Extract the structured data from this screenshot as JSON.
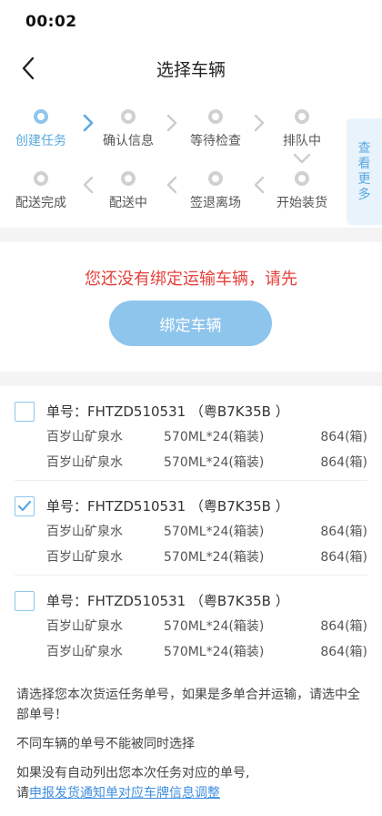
{
  "status": {
    "time": "00:02"
  },
  "header": {
    "title": "选择车辆"
  },
  "steps": [
    {
      "label": "创建任务",
      "active": true
    },
    {
      "label": "确认信息",
      "active": false
    },
    {
      "label": "等待检查",
      "active": false
    },
    {
      "label": "排队中",
      "active": false
    },
    {
      "label": "开始装货",
      "active": false
    },
    {
      "label": "签退离场",
      "active": false
    },
    {
      "label": "配送中",
      "active": false
    },
    {
      "label": "配送完成",
      "active": false
    }
  ],
  "more_tab": {
    "chars": [
      "查",
      "看",
      "更",
      "多"
    ]
  },
  "bind": {
    "warning": "您还没有绑定运输车辆，请先",
    "button": "绑定车辆"
  },
  "orders": [
    {
      "checked": false,
      "number": "单号：FHTZD510531 （粤B7K35B ）",
      "items": [
        {
          "name": "百岁山矿泉水",
          "spec": "570ML*24(箱装)",
          "qty": "864(箱)"
        },
        {
          "name": "百岁山矿泉水",
          "spec": "570ML*24(箱装)",
          "qty": "864(箱)"
        }
      ]
    },
    {
      "checked": true,
      "number": "单号：FHTZD510531 （粤B7K35B ）",
      "items": [
        {
          "name": "百岁山矿泉水",
          "spec": "570ML*24(箱装)",
          "qty": "864(箱)"
        },
        {
          "name": "百岁山矿泉水",
          "spec": "570ML*24(箱装)",
          "qty": "864(箱)"
        }
      ]
    },
    {
      "checked": false,
      "number": "单号：FHTZD510531 （粤B7K35B ）",
      "items": [
        {
          "name": "百岁山矿泉水",
          "spec": "570ML*24(箱装)",
          "qty": "864(箱)"
        },
        {
          "name": "百岁山矿泉水",
          "spec": "570ML*24(箱装)",
          "qty": "864(箱)"
        }
      ]
    }
  ],
  "notes": {
    "line1": "请选择您本次货运任务单号，如果是多单合并运输，请选中全部单号！",
    "line2": "不同车辆的单号不能被同时选择",
    "line3": "如果没有自动列出您本次任务对应的单号,",
    "line4_prefix": "请",
    "line4_link": "申报发货通知单对应车牌信息调整"
  },
  "colors": {
    "accent": "#5aa9e0",
    "warning": "#e5403a",
    "button": "#8ec5ec"
  }
}
